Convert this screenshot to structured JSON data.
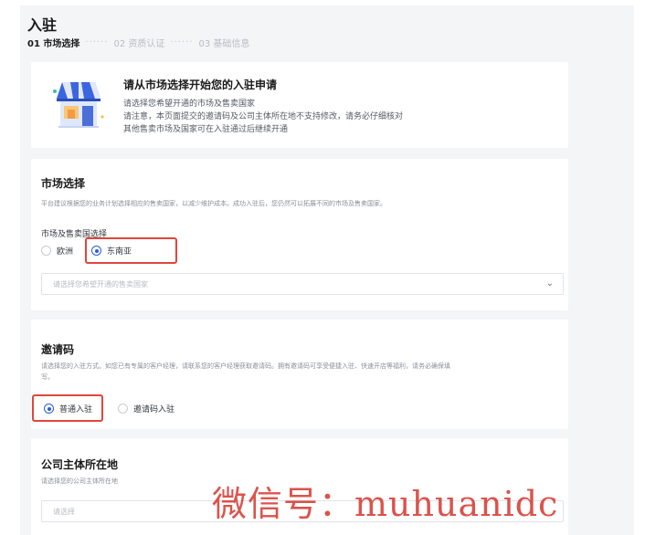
{
  "header": {
    "title": "入驻",
    "steps": [
      {
        "label": "01 市场选择",
        "active": true
      },
      {
        "label": "02 资质认证",
        "active": false
      },
      {
        "label": "03 基础信息",
        "active": false
      }
    ],
    "step_separator": "······"
  },
  "intro": {
    "illustration_icon": "shop-storefront-icon",
    "title": "请从市场选择开始您的入驻申请",
    "lines": [
      "请选择您希望开通的市场及售卖国家",
      "请注意，本页面提交的邀请码及公司主体所在地不支持修改，请务必仔细核对",
      "其他售卖市场及国家可在入驻通过后继续开通"
    ]
  },
  "market": {
    "title": "市场选择",
    "description": "平台建议根据您的业务计划选择相应的售卖国家，以减少维护成本。成功入驻后，您仍然可以拓展不同的市场及售卖国家。",
    "field_label": "市场及售卖国选择",
    "options": [
      {
        "label": "欧洲",
        "checked": false
      },
      {
        "label": "东南亚",
        "checked": true
      }
    ],
    "country_placeholder": "请选择您希望开通的售卖国家",
    "chevron_icon": "chevron-down-icon"
  },
  "invite": {
    "title": "邀请码",
    "description_line1": "请选择您的入驻方式。如您已有专属的客户经理，请联系您的客户经理获取邀请码。拥有邀请码可享受便捷入驻、快速开店等福利，请务必确保填",
    "description_line2": "写。",
    "options": [
      {
        "label": "普通入驻",
        "checked": true
      },
      {
        "label": "邀请码入驻",
        "checked": false
      }
    ]
  },
  "company": {
    "title": "公司主体所在地",
    "description": "请选择您的公司主体所在地",
    "placeholder": "请选择"
  },
  "watermark": {
    "text": "微信号：muhuanidc"
  },
  "colors": {
    "accent": "#2a5bd7",
    "highlight": "#e0463b",
    "watermark": "#d9453d",
    "page_bg": "#f4f5f7"
  }
}
